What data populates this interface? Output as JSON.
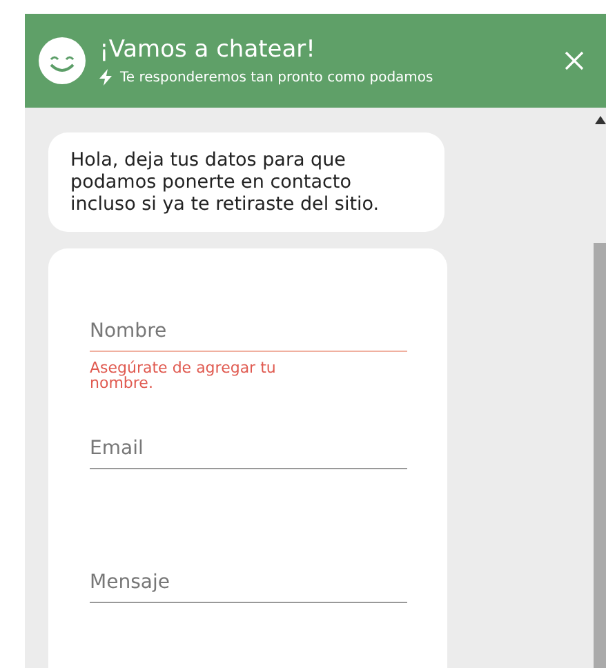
{
  "header": {
    "title": "¡Vamos a chatear!",
    "subtitle": "Te responderemos tan pronto como podamos"
  },
  "message": "Hola, deja tus datos para que podamos ponerte en contacto incluso si ya te retiraste del sitio.",
  "fields": [
    {
      "placeholder": "Nombre",
      "invalid": true,
      "error": "Asegúrate de agregar tu nombre."
    },
    {
      "placeholder": "Email",
      "invalid": false
    },
    {
      "placeholder": "Mensaje",
      "invalid": false
    }
  ]
}
